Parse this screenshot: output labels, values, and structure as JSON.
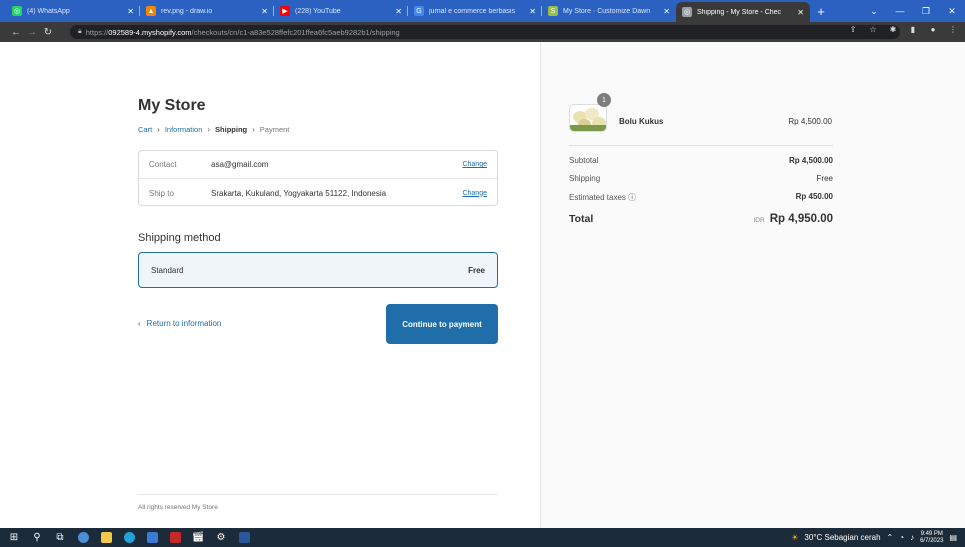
{
  "browser": {
    "tabs": [
      {
        "title": "(4) WhatsApp",
        "color": "#25d366",
        "glyph": "◎"
      },
      {
        "title": "rev.png - draw.io",
        "color": "#f08705",
        "glyph": "▲"
      },
      {
        "title": "(228) YouTube",
        "color": "#ff0000",
        "glyph": "▶"
      },
      {
        "title": "jurnal e commerce berbasis",
        "color": "#4285f4",
        "glyph": "G"
      },
      {
        "title": "My Store · Customize Dawn",
        "color": "#95bf47",
        "glyph": "S"
      },
      {
        "title": "Shipping - My Store - Chec",
        "color": "#9aa0a6",
        "glyph": "◎"
      }
    ],
    "url_prefix": "https://",
    "url_host": "092589-4.myshopify.com",
    "url_path": "/checkouts/cn/c1-a83e528ffefc201ffea6fc5aeb9282b1/shipping"
  },
  "checkout": {
    "store_name": "My Store",
    "breadcrumb": {
      "cart": "Cart",
      "information": "Information",
      "shipping": "Shipping",
      "payment": "Payment"
    },
    "review": {
      "contact_label": "Contact",
      "contact_value": "asa@gmail.com",
      "ship_label": "Ship to",
      "ship_value": "Srakarta, Kukuland, Yogyakarta 51122, Indonesia",
      "change": "Change"
    },
    "shipping_method_title": "Shipping method",
    "method": {
      "name": "Standard",
      "price": "Free"
    },
    "return_label": "Return to information",
    "continue_label": "Continue to payment",
    "footer": "All rights reserved My Store"
  },
  "summary": {
    "product": {
      "name": "Bolu Kukus",
      "qty": "1",
      "price": "Rp 4,500.00"
    },
    "subtotal_label": "Subtotal",
    "subtotal": "Rp 4,500.00",
    "shipping_label": "Shipping",
    "shipping": "Free",
    "taxes_label": "Estimated taxes ⓘ",
    "taxes": "Rp 450.00",
    "total_label": "Total",
    "total_currency": "IDR",
    "total": "Rp 4,950.00"
  },
  "taskbar": {
    "weather": "30°C Sebagian cerah",
    "time": "9:49 PM",
    "date": "6/7/2023"
  }
}
